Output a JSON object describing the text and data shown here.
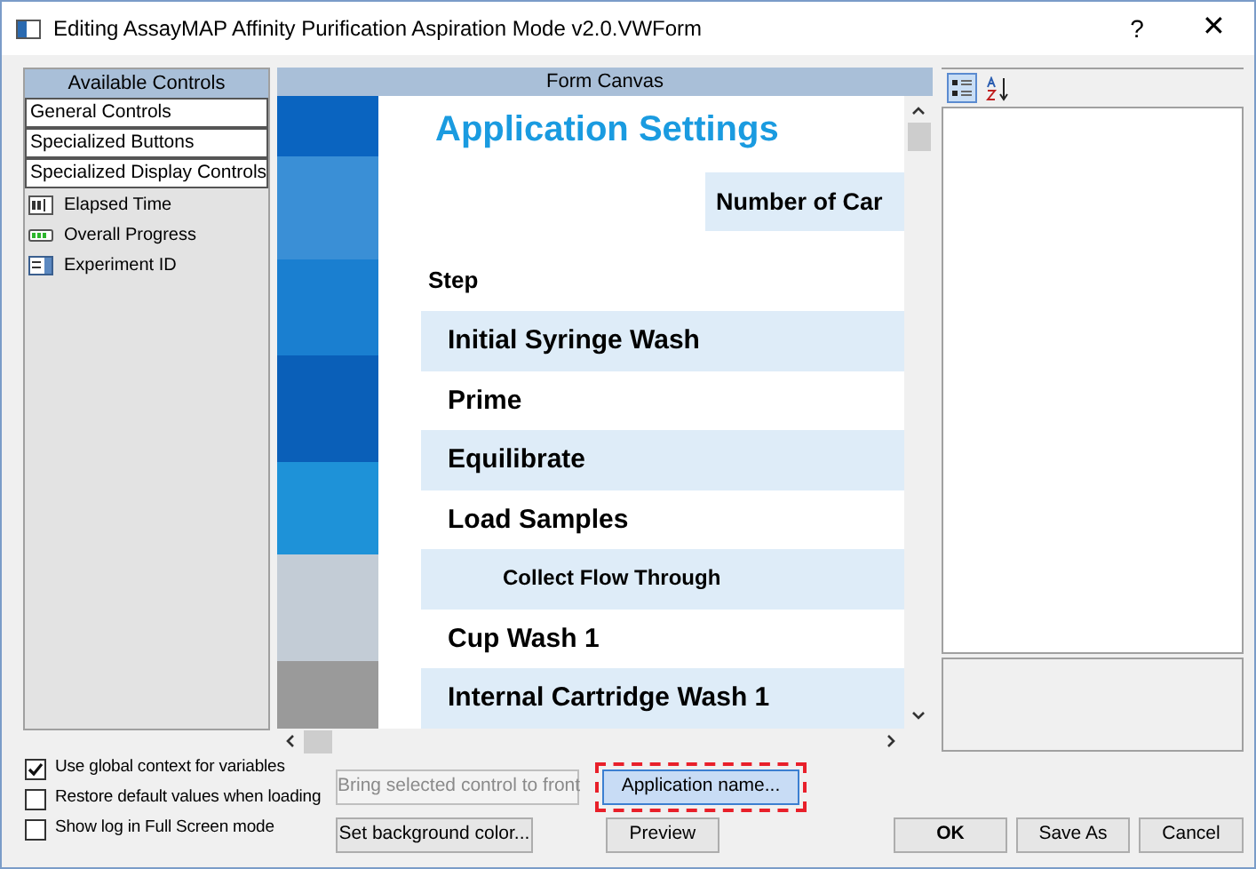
{
  "window": {
    "title": "Editing AssayMAP Affinity Purification Aspiration Mode v2.0.VWForm",
    "help": "?",
    "close": "✕"
  },
  "available_controls": {
    "header": "Available Controls",
    "categories": [
      {
        "label": "General Controls"
      },
      {
        "label": "Specialized Buttons"
      },
      {
        "label": "Specialized Display Controls"
      }
    ],
    "items": [
      {
        "label": "Elapsed Time",
        "kind": "textbox"
      },
      {
        "label": "Overall Progress",
        "kind": "progress"
      },
      {
        "label": "Experiment ID",
        "kind": "combo"
      }
    ]
  },
  "form_canvas": {
    "header": "Form Canvas",
    "title": "Application Settings",
    "number_label": "Number of Car",
    "step_header": "Step",
    "steps": [
      {
        "label": "Initial Syringe Wash",
        "shaded": true,
        "indented": false
      },
      {
        "label": "Prime",
        "shaded": false,
        "indented": false
      },
      {
        "label": "Equilibrate",
        "shaded": true,
        "indented": false
      },
      {
        "label": "Load Samples",
        "shaded": false,
        "indented": false
      },
      {
        "label": "Collect Flow Through",
        "shaded": true,
        "indented": true
      },
      {
        "label": "Cup Wash 1",
        "shaded": false,
        "indented": false
      },
      {
        "label": "Internal Cartridge Wash 1",
        "shaded": true,
        "indented": false
      }
    ]
  },
  "properties": {
    "categorized_selected": true
  },
  "options": [
    {
      "label": "Use global context for variables",
      "checked": true
    },
    {
      "label": "Restore default values when loading",
      "checked": false
    },
    {
      "label": "Show log in Full Screen mode",
      "checked": false
    }
  ],
  "buttons": [
    {
      "label": "Bring selected control to front",
      "disabled": true,
      "highlighted": false,
      "kind": "middle"
    },
    {
      "label": "Application name...",
      "disabled": false,
      "highlighted": true,
      "kind": "middle"
    },
    {
      "label": "Set background color...",
      "disabled": false,
      "highlighted": false,
      "kind": "middle"
    },
    {
      "label": "Preview",
      "disabled": false,
      "highlighted": false,
      "kind": "middle"
    },
    {
      "label": "OK",
      "disabled": false,
      "highlighted": false,
      "kind": "dialog",
      "default": true
    },
    {
      "label": "Save As",
      "disabled": false,
      "highlighted": false,
      "kind": "dialog",
      "default": false
    },
    {
      "label": "Cancel",
      "disabled": false,
      "highlighted": false,
      "kind": "dialog",
      "default": false
    }
  ]
}
